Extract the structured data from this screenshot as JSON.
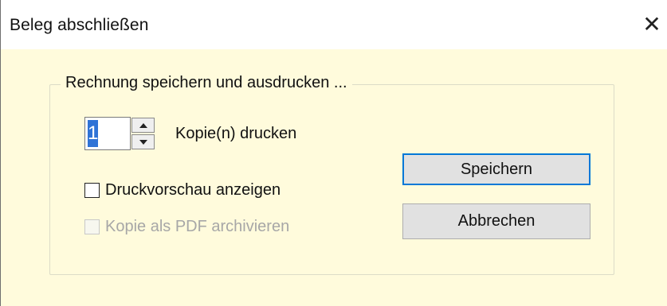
{
  "window": {
    "title": "Beleg abschließen",
    "close_glyph": "✕"
  },
  "group": {
    "title": "Rechnung speichern und ausdrucken ..."
  },
  "copies": {
    "value": "1",
    "label": "Kopie(n) drucken"
  },
  "options": {
    "preview_label": "Druckvorschau anzeigen",
    "preview_checked": false,
    "pdf_label": "Kopie als PDF archivieren",
    "pdf_checked": false,
    "pdf_enabled": false
  },
  "buttons": {
    "save_label": "Speichern",
    "cancel_label": "Abbrechen"
  },
  "colors": {
    "dialog_background": "#fffbdc",
    "selection": "#2f73d6",
    "default_button_border": "#0078d7",
    "disabled_text": "#a7a7a7"
  }
}
